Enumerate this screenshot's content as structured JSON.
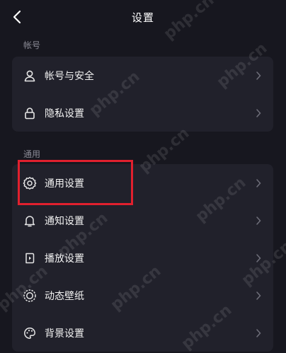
{
  "header": {
    "title": "设置"
  },
  "sections": [
    {
      "label": "帐号",
      "items": [
        {
          "label": "帐号与安全",
          "icon": "person-icon"
        },
        {
          "label": "隐私设置",
          "icon": "lock-icon"
        }
      ]
    },
    {
      "label": "通用",
      "items": [
        {
          "label": "通用设置",
          "icon": "gear-icon"
        },
        {
          "label": "通知设置",
          "icon": "bell-icon"
        },
        {
          "label": "播放设置",
          "icon": "play-settings-icon"
        },
        {
          "label": "动态壁纸",
          "icon": "wallpaper-icon"
        },
        {
          "label": "背景设置",
          "icon": "palette-icon"
        }
      ]
    }
  ],
  "annotation": {
    "highlight_color": "#e1202e",
    "highlighted_item": "通用设置"
  },
  "watermark": "php.cn"
}
